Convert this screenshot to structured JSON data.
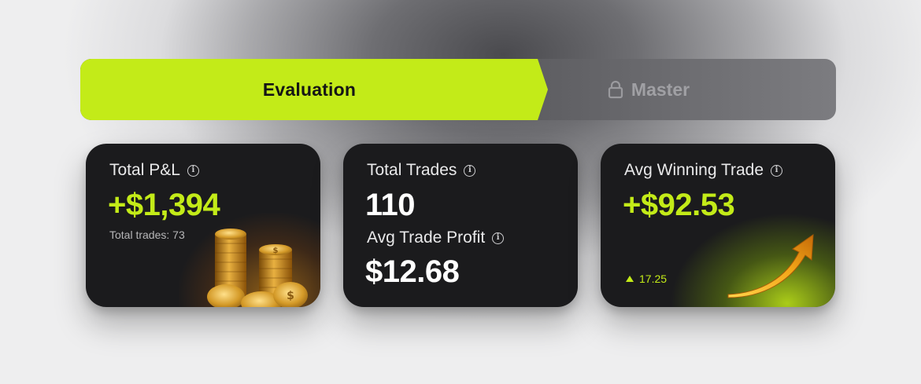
{
  "stepper": {
    "active_label": "Evaluation",
    "locked_label": "Master",
    "locked_icon": "lock-icon"
  },
  "cards": {
    "pnl": {
      "title": "Total P&L",
      "value": "+$1,394",
      "sub": "Total trades: 73",
      "icon": "info-icon",
      "image": "gold-coins"
    },
    "trades": {
      "title": "Total Trades",
      "value": "110",
      "title2": "Avg Trade Profit",
      "value2": "$12.68",
      "icon": "info-icon"
    },
    "winning": {
      "title": "Avg Winning Trade",
      "value": "+$92.53",
      "delta": "17.25",
      "delta_icon": "up-triangle-icon",
      "image": "gold-arrow"
    }
  },
  "colors": {
    "accent": "#c3eb18",
    "card": "#1b1b1d",
    "text": "#e9e9ea"
  }
}
